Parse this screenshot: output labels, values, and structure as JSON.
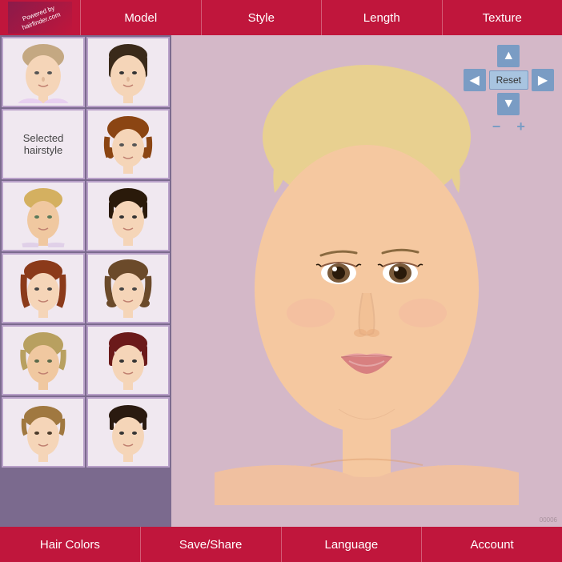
{
  "app": {
    "powered_by": "Powered by",
    "brand": "hairfinder.com"
  },
  "top_nav": {
    "tabs": [
      {
        "label": "Model",
        "id": "model"
      },
      {
        "label": "Style",
        "id": "style"
      },
      {
        "label": "Length",
        "id": "length"
      },
      {
        "label": "Texture",
        "id": "texture"
      }
    ]
  },
  "sidebar": {
    "selected_label": "Selected hairstyle",
    "hairstyles": [
      {
        "id": 1,
        "name": "short-straight-blonde",
        "row": 0,
        "col": 0
      },
      {
        "id": 2,
        "name": "short-dark-bob",
        "row": 0,
        "col": 1
      },
      {
        "id": 3,
        "name": "selected-placeholder",
        "row": 1,
        "col": 0
      },
      {
        "id": 4,
        "name": "wavy-brown",
        "row": 1,
        "col": 1
      },
      {
        "id": 5,
        "name": "short-blonde-pixie",
        "row": 2,
        "col": 0
      },
      {
        "id": 6,
        "name": "short-dark-bob2",
        "row": 2,
        "col": 1
      },
      {
        "id": 7,
        "name": "medium-auburn",
        "row": 3,
        "col": 0
      },
      {
        "id": 8,
        "name": "medium-layered",
        "row": 3,
        "col": 1
      },
      {
        "id": 9,
        "name": "short-wavy",
        "row": 4,
        "col": 0
      },
      {
        "id": 10,
        "name": "dark-red-bob",
        "row": 4,
        "col": 1
      },
      {
        "id": 11,
        "name": "light-brown-short",
        "row": 5,
        "col": 0
      },
      {
        "id": 12,
        "name": "dark-pixie",
        "row": 5,
        "col": 1
      }
    ]
  },
  "controls": {
    "reset_label": "Reset",
    "up_icon": "▲",
    "down_icon": "▼",
    "left_icon": "◀",
    "right_icon": "▶",
    "minus_icon": "−",
    "plus_icon": "+"
  },
  "watermark": "00006",
  "bottom_nav": {
    "items": [
      {
        "label": "Hair Colors",
        "id": "hair-colors"
      },
      {
        "label": "Save/Share",
        "id": "save-share"
      },
      {
        "label": "Language",
        "id": "language"
      },
      {
        "label": "Account",
        "id": "account"
      }
    ]
  }
}
